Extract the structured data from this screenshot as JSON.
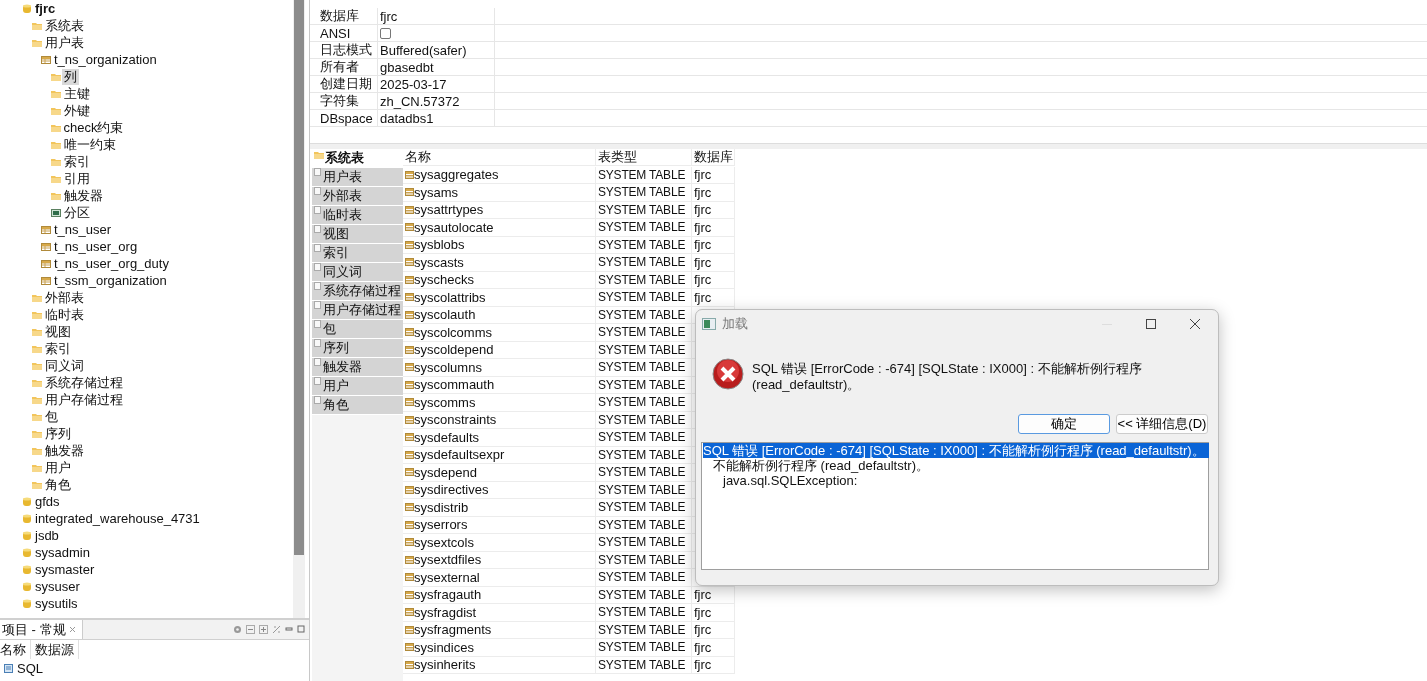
{
  "tree": [
    {
      "label": "fjrc",
      "kind": "database",
      "active": true,
      "selected": false,
      "children": [
        {
          "label": "系统表",
          "kind": "folder",
          "selected": false
        },
        {
          "label": "用户表",
          "kind": "folder",
          "selected": false,
          "children": [
            {
              "label": "t_ns_organization",
              "kind": "table",
              "selected": false,
              "children": [
                {
                  "label": "列",
                  "kind": "folder",
                  "selected": true
                },
                {
                  "label": "主键",
                  "kind": "folder",
                  "selected": false
                },
                {
                  "label": "外键",
                  "kind": "folder",
                  "selected": false
                },
                {
                  "label": "check约束",
                  "kind": "folder",
                  "selected": false
                },
                {
                  "label": "唯一约束",
                  "kind": "folder",
                  "selected": false
                },
                {
                  "label": "索引",
                  "kind": "folder",
                  "selected": false
                },
                {
                  "label": "引用",
                  "kind": "folder",
                  "selected": false
                },
                {
                  "label": "触发器",
                  "kind": "folder",
                  "selected": false
                },
                {
                  "label": "分区",
                  "kind": "partition",
                  "selected": false
                }
              ]
            },
            {
              "label": "t_ns_user",
              "kind": "table",
              "selected": false
            },
            {
              "label": "t_ns_user_org",
              "kind": "table",
              "selected": false
            },
            {
              "label": "t_ns_user_org_duty",
              "kind": "table",
              "selected": false
            },
            {
              "label": "t_ssm_organization",
              "kind": "table",
              "selected": false
            }
          ]
        },
        {
          "label": "外部表",
          "kind": "folder",
          "selected": false
        },
        {
          "label": "临时表",
          "kind": "folder",
          "selected": false
        },
        {
          "label": "视图",
          "kind": "folder",
          "selected": false
        },
        {
          "label": "索引",
          "kind": "folder",
          "selected": false
        },
        {
          "label": "同义词",
          "kind": "folder",
          "selected": false
        },
        {
          "label": "系统存储过程",
          "kind": "folder",
          "selected": false
        },
        {
          "label": "用户存储过程",
          "kind": "folder",
          "selected": false
        },
        {
          "label": "包",
          "kind": "folder",
          "selected": false
        },
        {
          "label": "序列",
          "kind": "folder",
          "selected": false
        },
        {
          "label": "触发器",
          "kind": "folder",
          "selected": false
        },
        {
          "label": "用户",
          "kind": "folder",
          "selected": false
        },
        {
          "label": "角色",
          "kind": "folder",
          "selected": false
        }
      ]
    },
    {
      "label": "gfds",
      "kind": "database",
      "active": false,
      "selected": false
    },
    {
      "label": "integrated_warehouse_4731",
      "kind": "database",
      "active": false,
      "selected": false
    },
    {
      "label": "jsdb",
      "kind": "database",
      "active": false,
      "selected": false
    },
    {
      "label": "sysadmin",
      "kind": "database",
      "active": false,
      "selected": false
    },
    {
      "label": "sysmaster",
      "kind": "database",
      "active": false,
      "selected": false
    },
    {
      "label": "sysuser",
      "kind": "database",
      "active": false,
      "selected": false
    },
    {
      "label": "sysutils",
      "kind": "database",
      "active": false,
      "selected": false
    }
  ],
  "bottom_panel": {
    "title": "项目 - 常规",
    "columns": [
      "名称",
      "数据源"
    ],
    "rows": [
      {
        "name": "SQL"
      }
    ]
  },
  "properties": [
    {
      "name": "数据库",
      "kind": "text",
      "value": "fjrc"
    },
    {
      "name": "ANSI",
      "kind": "checkbox",
      "checked": false
    },
    {
      "name": "日志模式",
      "kind": "text",
      "value": "Buffered(safer)"
    },
    {
      "name": "所有者",
      "kind": "text",
      "value": "gbasedbt"
    },
    {
      "name": "创建日期",
      "kind": "text",
      "value": "2025-03-17"
    },
    {
      "name": "字符集",
      "kind": "text",
      "value": "zh_CN.57372"
    },
    {
      "name": "DBspace",
      "kind": "text",
      "value": "datadbs1"
    }
  ],
  "object_tabs": [
    {
      "label": "系统表",
      "selected": true
    },
    {
      "label": "用户表",
      "selected": false
    },
    {
      "label": "外部表",
      "selected": false
    },
    {
      "label": "临时表",
      "selected": false
    },
    {
      "label": "视图",
      "selected": false
    },
    {
      "label": "索引",
      "selected": false
    },
    {
      "label": "同义词",
      "selected": false
    },
    {
      "label": "系统存储过程",
      "selected": false
    },
    {
      "label": "用户存储过程",
      "selected": false
    },
    {
      "label": "包",
      "selected": false
    },
    {
      "label": "序列",
      "selected": false
    },
    {
      "label": "触发器",
      "selected": false
    },
    {
      "label": "用户",
      "selected": false
    },
    {
      "label": "角色",
      "selected": false
    }
  ],
  "objects": {
    "columns": [
      "名称",
      "表类型",
      "数据库"
    ],
    "rows": [
      {
        "name": "sysaggregates",
        "type": "SYSTEM TABLE",
        "database": "fjrc"
      },
      {
        "name": "sysams",
        "type": "SYSTEM TABLE",
        "database": "fjrc"
      },
      {
        "name": "sysattrtypes",
        "type": "SYSTEM TABLE",
        "database": "fjrc"
      },
      {
        "name": "sysautolocate",
        "type": "SYSTEM TABLE",
        "database": "fjrc"
      },
      {
        "name": "sysblobs",
        "type": "SYSTEM TABLE",
        "database": "fjrc"
      },
      {
        "name": "syscasts",
        "type": "SYSTEM TABLE",
        "database": "fjrc"
      },
      {
        "name": "syschecks",
        "type": "SYSTEM TABLE",
        "database": "fjrc"
      },
      {
        "name": "syscolattribs",
        "type": "SYSTEM TABLE",
        "database": "fjrc"
      },
      {
        "name": "syscolauth",
        "type": "SYSTEM TABLE"
      },
      {
        "name": "syscolcomms",
        "type": "SYSTEM TABLE"
      },
      {
        "name": "syscoldepend",
        "type": "SYSTEM TABLE"
      },
      {
        "name": "syscolumns",
        "type": "SYSTEM TABLE"
      },
      {
        "name": "syscommauth",
        "type": "SYSTEM TABLE"
      },
      {
        "name": "syscomms",
        "type": "SYSTEM TABLE"
      },
      {
        "name": "sysconstraints",
        "type": "SYSTEM TABLE"
      },
      {
        "name": "sysdefaults",
        "type": "SYSTEM TABLE"
      },
      {
        "name": "sysdefaultsexpr",
        "type": "SYSTEM TABLE"
      },
      {
        "name": "sysdepend",
        "type": "SYSTEM TABLE"
      },
      {
        "name": "sysdirectives",
        "type": "SYSTEM TABLE"
      },
      {
        "name": "sysdistrib",
        "type": "SYSTEM TABLE"
      },
      {
        "name": "syserrors",
        "type": "SYSTEM TABLE"
      },
      {
        "name": "sysextcols",
        "type": "SYSTEM TABLE"
      },
      {
        "name": "sysextdfiles",
        "type": "SYSTEM TABLE"
      },
      {
        "name": "sysexternal",
        "type": "SYSTEM TABLE"
      },
      {
        "name": "sysfragauth",
        "type": "SYSTEM TABLE",
        "database": "fjrc"
      },
      {
        "name": "sysfragdist",
        "type": "SYSTEM TABLE",
        "database": "fjrc"
      },
      {
        "name": "sysfragments",
        "type": "SYSTEM TABLE",
        "database": "fjrc"
      },
      {
        "name": "sysindices",
        "type": "SYSTEM TABLE",
        "database": "fjrc"
      },
      {
        "name": "sysinherits",
        "type": "SYSTEM TABLE",
        "database": "fjrc"
      }
    ]
  },
  "dialog": {
    "title": "加载",
    "message": "SQL 错误 [ErrorCode : -674]  [SQLState : IX000] : 不能解析例行程序 (read_defaultstr)。",
    "buttons": [
      "确定",
      "<< 详细信息(D)"
    ],
    "details": [
      {
        "text": "SQL 错误 [ErrorCode : -674]  [SQLState : IX000] : 不能解析例行程序 (read_defaultstr)。",
        "selected": true,
        "children": [
          {
            "text": "不能解析例行程序 (read_defaultstr)。",
            "selected": false,
            "children": [
              {
                "text": "java.sql.SQLException:",
                "selected": false
              }
            ]
          }
        ]
      }
    ]
  }
}
